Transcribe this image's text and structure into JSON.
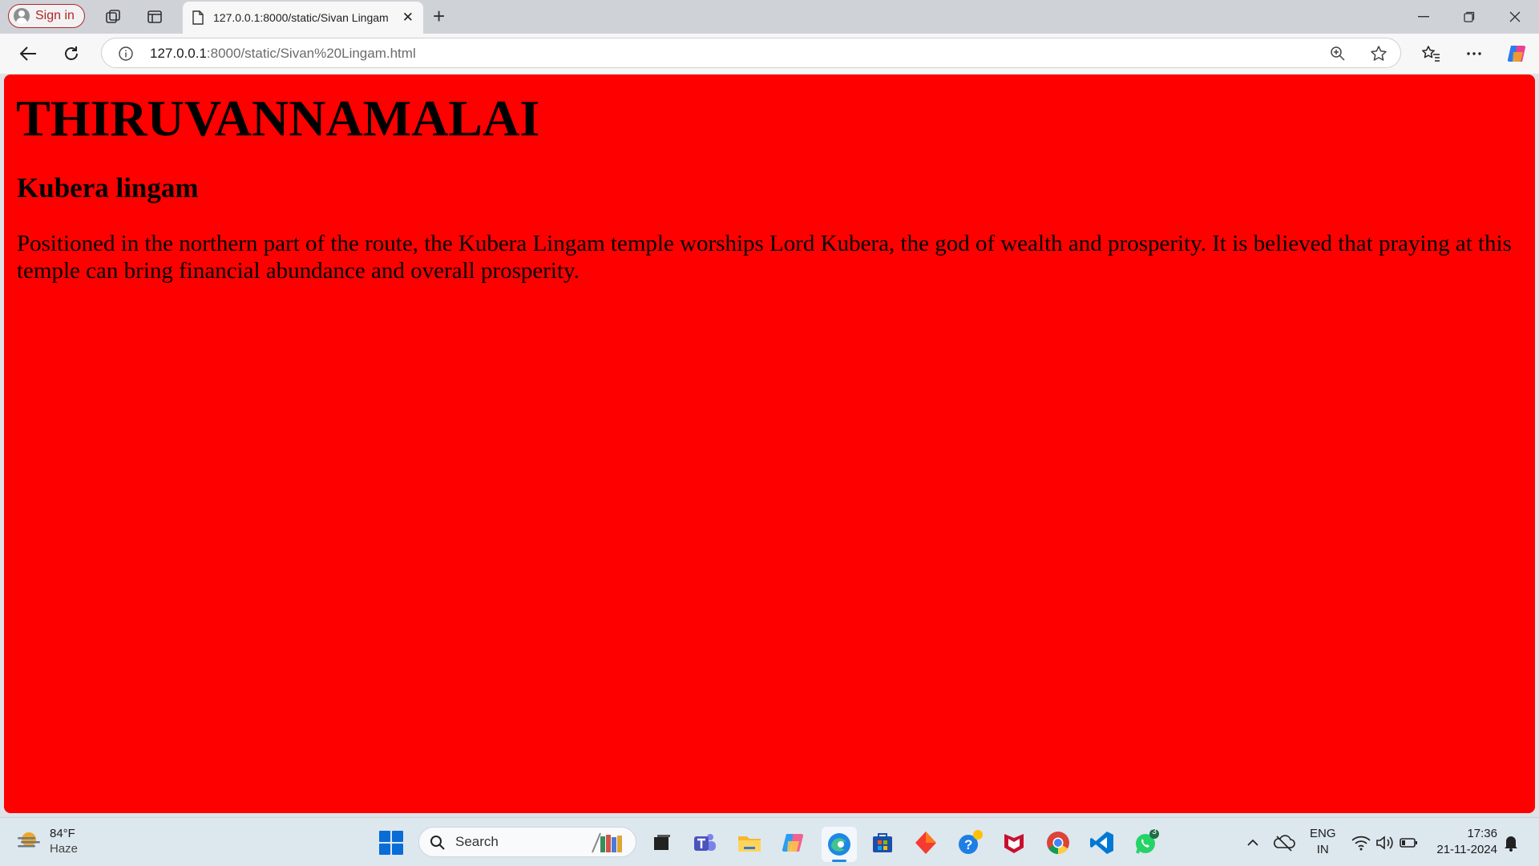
{
  "browser": {
    "signin_label": "Sign in",
    "tab_title": "127.0.0.1:8000/static/Sivan Lingam",
    "url_host": "127.0.0.1",
    "url_rest": ":8000/static/Sivan%20Lingam.html"
  },
  "page": {
    "heading": "THIRUVANNAMALAI",
    "subheading": "Kubera lingam",
    "paragraph": "Positioned in the northern part of the route, the Kubera Lingam temple worships Lord Kubera, the god of wealth and prosperity. It is believed that praying at this temple can bring financial abundance and overall prosperity.",
    "background_color": "#ff0000"
  },
  "taskbar": {
    "weather_temp": "84°F",
    "weather_desc": "Haze",
    "search_label": "Search",
    "lang_top": "ENG",
    "lang_bottom": "IN",
    "time": "17:36",
    "date": "21-11-2024",
    "whatsapp_badge": "3"
  }
}
